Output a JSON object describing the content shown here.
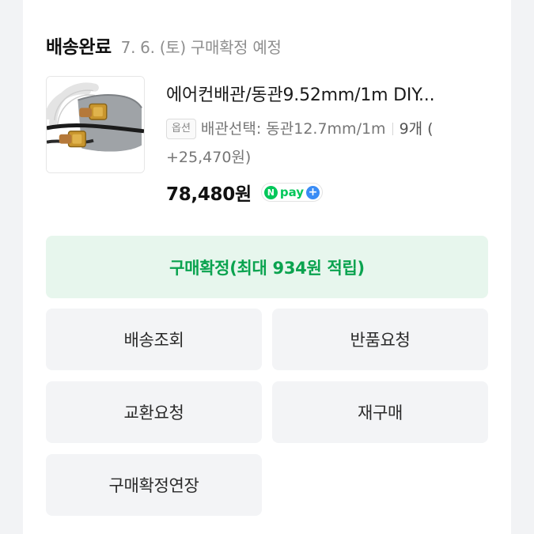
{
  "order": {
    "status": "배송완료",
    "date_note": "7. 6. (토) 구매확정 예정"
  },
  "product": {
    "name": "에어컨배관/동관9.52mm/1m DIY...",
    "option_badge": "옵션",
    "option_text": "배관선택: 동관12.7mm/1m",
    "option_qty": "9개 (",
    "option_extra": "+25,470원)",
    "price": "78,480원",
    "npay": {
      "n": "N",
      "text": "pay",
      "plus": "+"
    }
  },
  "actions": {
    "confirm": "구매확정(최대 934원 적립)",
    "track": "배송조회",
    "return": "반품요청",
    "exchange": "교환요청",
    "rebuy": "재구매",
    "extend": "구매확정연장"
  },
  "colors": {
    "confirm_bg": "#e7f6ed",
    "confirm_text": "#0aa34f",
    "npay_green": "#03c75a",
    "npay_plus_blue": "#3a8cf5"
  }
}
